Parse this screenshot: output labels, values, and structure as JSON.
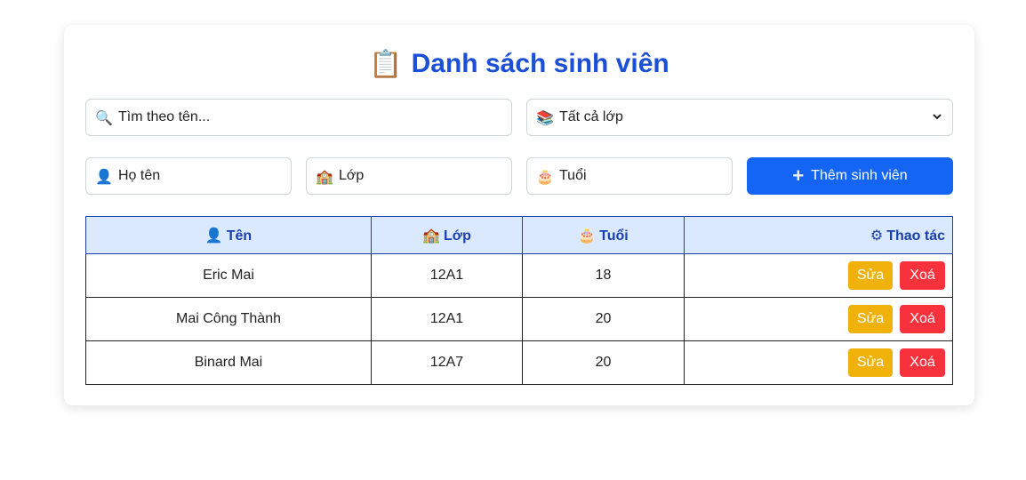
{
  "header": {
    "icon": "clipboard-icon",
    "title": "Danh sách sinh viên"
  },
  "filters": {
    "search_placeholder": "Tìm theo tên...",
    "class_select": {
      "selected": "Tất cả lớp",
      "options": [
        "Tất cả lớp"
      ]
    }
  },
  "form": {
    "name_placeholder": "Họ tên",
    "class_placeholder": "Lớp",
    "age_placeholder": "Tuổi",
    "add_button_label": "Thêm sinh viên"
  },
  "table": {
    "headers": {
      "name": "Tên",
      "class": "Lớp",
      "age": "Tuổi",
      "actions": "Thao tác"
    },
    "rows": [
      {
        "name": "Eric Mai",
        "class": "12A1",
        "age": "18"
      },
      {
        "name": "Mai Công Thành",
        "class": "12A1",
        "age": "20"
      },
      {
        "name": "Binard Mai",
        "class": "12A7",
        "age": "20"
      }
    ],
    "edit_label": "Sửa",
    "delete_label": "Xoá"
  },
  "colors": {
    "title": "#1a4fd6",
    "primary": "#1565f5",
    "header_bg": "#dbe9ff",
    "edit": "#f0b10a",
    "delete": "#f8323c"
  }
}
